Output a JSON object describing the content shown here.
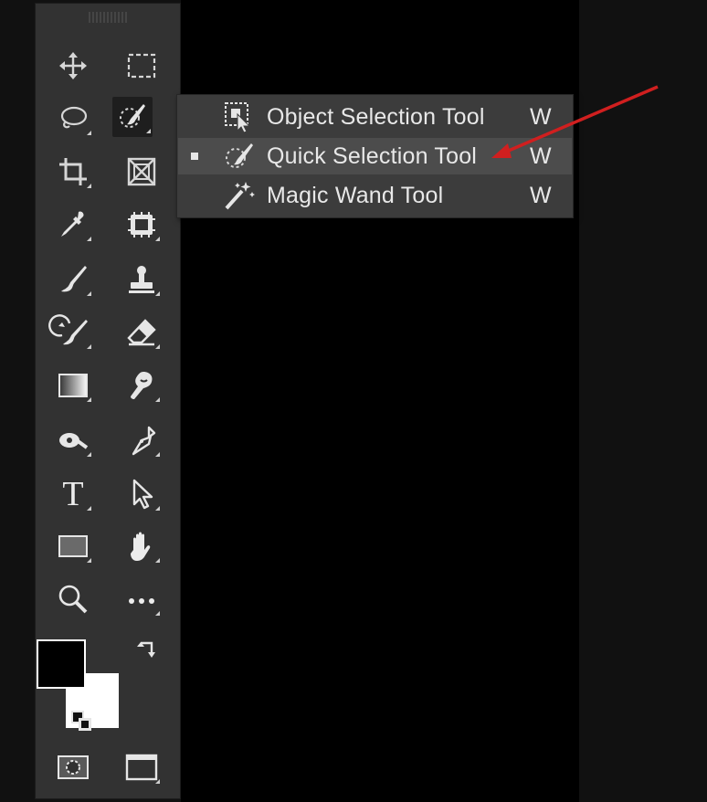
{
  "toolbar": {
    "tools": [
      {
        "name": "move-tool",
        "icon": "move-icon",
        "has_submenu": false
      },
      {
        "name": "rectangular-marquee-tool",
        "icon": "marquee-icon",
        "has_submenu": false
      },
      {
        "name": "lasso-tool",
        "icon": "lasso-icon",
        "has_submenu": true
      },
      {
        "name": "quick-selection-tool",
        "icon": "quick-selection-icon",
        "has_submenu": true,
        "active": true
      },
      {
        "name": "crop-tool",
        "icon": "crop-icon",
        "has_submenu": true
      },
      {
        "name": "frame-tool",
        "icon": "frame-icon",
        "has_submenu": false
      },
      {
        "name": "eyedropper-tool",
        "icon": "eyedropper-icon",
        "has_submenu": true
      },
      {
        "name": "spot-healing-tool",
        "icon": "bandage-icon",
        "has_submenu": true
      },
      {
        "name": "brush-tool",
        "icon": "brush-icon",
        "has_submenu": true
      },
      {
        "name": "clone-stamp-tool",
        "icon": "stamp-icon",
        "has_submenu": true
      },
      {
        "name": "history-brush-tool",
        "icon": "history-brush-icon",
        "has_submenu": true
      },
      {
        "name": "eraser-tool",
        "icon": "eraser-icon",
        "has_submenu": true
      },
      {
        "name": "gradient-tool",
        "icon": "gradient-icon",
        "has_submenu": true
      },
      {
        "name": "blur-tool",
        "icon": "blur-icon",
        "has_submenu": true
      },
      {
        "name": "dodge-tool",
        "icon": "dodge-icon",
        "has_submenu": true
      },
      {
        "name": "pen-tool",
        "icon": "pen-icon",
        "has_submenu": true
      },
      {
        "name": "type-tool",
        "icon": "type-icon",
        "has_submenu": true
      },
      {
        "name": "path-selection-tool",
        "icon": "arrow-icon",
        "has_submenu": true
      },
      {
        "name": "rectangle-tool",
        "icon": "rectangle-icon",
        "has_submenu": true
      },
      {
        "name": "hand-tool",
        "icon": "hand-icon",
        "has_submenu": true
      },
      {
        "name": "zoom-tool",
        "icon": "zoom-icon",
        "has_submenu": false
      },
      {
        "name": "edit-toolbar",
        "icon": "more-icon",
        "has_submenu": true
      }
    ],
    "type_glyph": "T",
    "foreground_color": "#000000",
    "background_color": "#ffffff"
  },
  "flyout": {
    "items": [
      {
        "label": "Object Selection Tool",
        "shortcut": "W",
        "icon": "object-selection-icon",
        "selected": false
      },
      {
        "label": "Quick Selection Tool",
        "shortcut": "W",
        "icon": "quick-selection-icon",
        "selected": true
      },
      {
        "label": "Magic Wand Tool",
        "shortcut": "W",
        "icon": "magic-wand-icon",
        "selected": false
      }
    ]
  },
  "annotation": {
    "arrow_color": "#d01f1f"
  }
}
